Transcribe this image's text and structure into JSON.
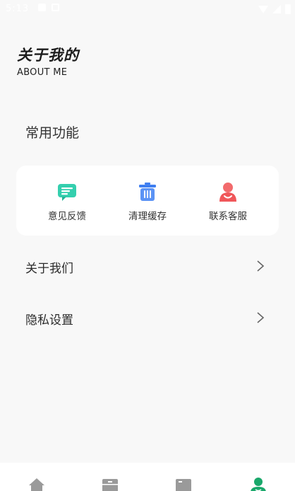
{
  "status": {
    "time": "5:13"
  },
  "header": {
    "title_cn": "关于我的",
    "title_en": "ABOUT ME"
  },
  "section": {
    "title": "常用功能"
  },
  "functions": [
    {
      "label": "意见反馈",
      "icon": "feedback-chat-icon",
      "color": "#2fc6a8"
    },
    {
      "label": "清理缓存",
      "icon": "trash-icon",
      "color": "#3f7ef0"
    },
    {
      "label": "联系客服",
      "icon": "customer-service-icon",
      "color": "#f0575a"
    }
  ],
  "menu": [
    {
      "label": "关于我们"
    },
    {
      "label": "隐私设置"
    }
  ],
  "tabbar": {
    "items": [
      "home-icon",
      "archive-icon",
      "book-icon",
      "profile-icon"
    ],
    "active_color": "#1aa86b",
    "inactive_color": "#9a9a9a"
  }
}
